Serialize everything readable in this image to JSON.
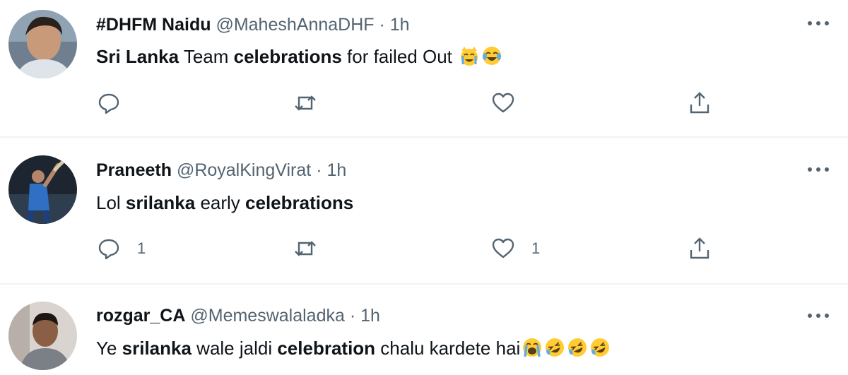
{
  "tweets": [
    {
      "display_name": "#DHFM Naidu",
      "handle": "@MaheshAnnaDHF",
      "dot": "·",
      "time": "1h",
      "text": {
        "p1": "Sri Lanka",
        "p2": " Team ",
        "p3": "celebrations",
        "p4": " for failed Out "
      },
      "emojis": [
        "crying-cat-face",
        "face-with-tears-of-joy"
      ],
      "reply_count": "",
      "retweet_count": "",
      "like_count": ""
    },
    {
      "display_name": "Praneeth",
      "handle": "@RoyalKingVirat",
      "dot": "·",
      "time": "1h",
      "text": {
        "p1": "Lol ",
        "p2": "srilanka",
        "p3": " early ",
        "p4": "celebrations"
      },
      "emojis": [],
      "reply_count": "1",
      "retweet_count": "",
      "like_count": "1"
    },
    {
      "display_name": "rozgar_CA",
      "handle": "@Memeswalaladka",
      "dot": "·",
      "time": "1h",
      "text": {
        "p1": "Ye ",
        "p2": "srilanka",
        "p3": " wale jaldi ",
        "p4": "celebration",
        "p5": " chalu kardete hai"
      },
      "emojis": [
        "loudly-crying-face",
        "rolling-on-the-floor-laughing",
        "rolling-on-the-floor-laughing",
        "rolling-on-the-floor-laughing"
      ],
      "reply_count": "",
      "retweet_count": "",
      "like_count": ""
    }
  ],
  "icons": {
    "reply": "reply-icon",
    "retweet": "retweet-icon",
    "like": "like-icon",
    "share": "share-icon",
    "more": "more-icon"
  },
  "colors": {
    "text_primary": "#0f1419",
    "text_secondary": "#536471",
    "divider": "#eff3f4",
    "emoji_yellow": "#ffcc33"
  }
}
